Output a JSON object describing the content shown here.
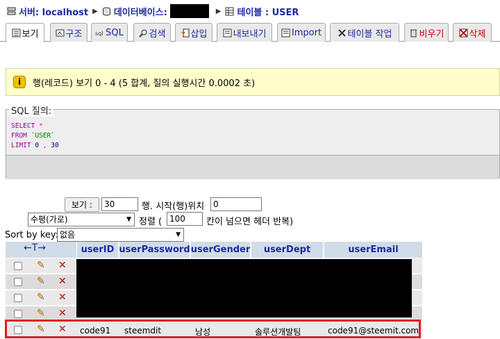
{
  "breadcrumb": {
    "server_label": "서버: localhost",
    "db_label": "데이터베이스:",
    "table_label": "테이블 : USER"
  },
  "tabs": [
    {
      "label": "보기",
      "icon": "browse-icon",
      "active": true
    },
    {
      "label": "구조",
      "icon": "structure-icon"
    },
    {
      "label": "SQL",
      "icon": "sql-icon"
    },
    {
      "label": "검색",
      "icon": "search-icon"
    },
    {
      "label": "삽입",
      "icon": "insert-icon"
    },
    {
      "label": "내보내기",
      "icon": "export-icon"
    },
    {
      "label": "Import",
      "icon": "import-icon"
    },
    {
      "label": "테이블 작업",
      "icon": "operations-icon"
    },
    {
      "label": "비우기",
      "icon": "empty-icon",
      "danger": true
    },
    {
      "label": "삭제",
      "icon": "drop-icon",
      "danger": true
    }
  ],
  "notice": {
    "text": "행(레코드) 보기 0 - 4 (5 합계, 질의 실행시간 0.0002 초)"
  },
  "sql": {
    "legend": "SQL 질의:",
    "select_kw": "SELECT",
    "star": "*",
    "from_kw": "FROM",
    "table": "`USER`",
    "limit_kw": "LIMIT",
    "offset": "0",
    "comma": ",",
    "count": "30"
  },
  "nav": {
    "show_button": "보기 :",
    "rows_value": "30",
    "start_label": "행. 시작(행)위치",
    "start_value": "0",
    "mode_value": "수평(가로)",
    "sort_label_pre": "정렬 (",
    "repeat_value": "100",
    "repeat_label": "칸이 넘으면 헤더 반복)",
    "sortkey_label": "Sort by key:",
    "sortkey_value": "없음"
  },
  "table": {
    "columns": [
      "userID",
      "userPassword",
      "userGender",
      "userDept",
      "userEmail"
    ],
    "visible_row": {
      "userID": "code91",
      "userPassword": "steemdit",
      "userGender": "남성",
      "userDept": "솔루션개발팀",
      "userEmail": "code91@steemit.com"
    }
  },
  "colors": {
    "link": "#1c2a9e",
    "header_bg": "#d0dce8",
    "notice_bg": "#ffffcc",
    "highlight": "#e8141e"
  }
}
